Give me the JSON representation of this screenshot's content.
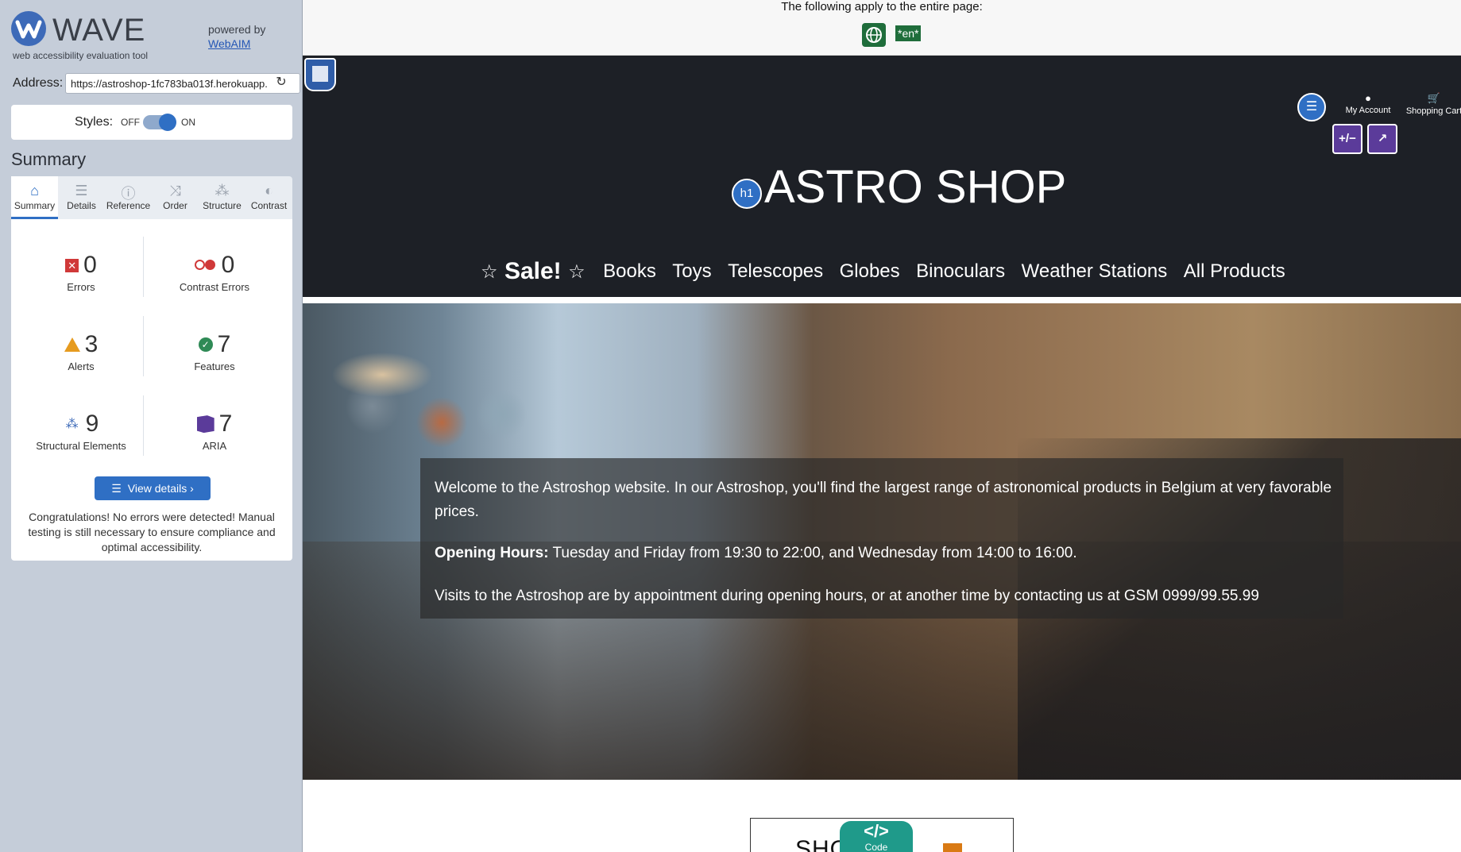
{
  "sidebar": {
    "logo_text": "WAVE",
    "logo_sub": "web accessibility evaluation tool",
    "powered_by": "powered by",
    "webaim_link": "WebAIM",
    "address_label": "Address:",
    "address_value": "https://astroshop-1fc783ba013f.herokuapp.",
    "styles_label": "Styles:",
    "styles_off": "OFF",
    "styles_on": "ON",
    "summary_title": "Summary",
    "tabs": [
      {
        "label": "Summary",
        "icon": "home-icon",
        "active": true
      },
      {
        "label": "Details",
        "icon": "list-icon",
        "active": false
      },
      {
        "label": "Reference",
        "icon": "info-icon",
        "active": false
      },
      {
        "label": "Order",
        "icon": "order-icon",
        "active": false
      },
      {
        "label": "Structure",
        "icon": "structure-icon",
        "active": false
      },
      {
        "label": "Contrast",
        "icon": "contrast-icon",
        "active": false
      }
    ],
    "stats": {
      "errors": {
        "value": "0",
        "label": "Errors"
      },
      "contrast_errors": {
        "value": "0",
        "label": "Contrast Errors"
      },
      "alerts": {
        "value": "3",
        "label": "Alerts"
      },
      "features": {
        "value": "7",
        "label": "Features"
      },
      "structural": {
        "value": "9",
        "label": "Structural Elements"
      },
      "aria": {
        "value": "7",
        "label": "ARIA"
      }
    },
    "view_details": "View details ›",
    "congrats": "Congratulations! No errors were detected! Manual testing is still necessary to ensure compliance and optimal accessibility."
  },
  "page": {
    "apply_text": "The following apply to the entire page:",
    "lang_badge": "*en*",
    "h1_badge": "h1",
    "site_title": "ASTRO SHOP",
    "account_label": "My Account",
    "cart_label": "Shopping Cart",
    "aria_badge_1": "+/−",
    "aria_badge_2": "↗",
    "nav": {
      "sale": "Sale!",
      "items": [
        "Books",
        "Toys",
        "Telescopes",
        "Globes",
        "Binoculars",
        "Weather Stations",
        "All Products"
      ]
    },
    "hero": {
      "welcome": "Welcome to the Astroshop website. In our Astroshop, you'll find the largest range of astronomical products in Belgium at very favorable prices.",
      "hours_label": "Opening Hours:",
      "hours_text": " Tuesday and Friday from 19:30 to 22:00, and Wednesday from 14:00 to 16:00.",
      "visits": "Visits to the Astroshop are by appointment during opening hours, or at another time by contacting us at GSM 0999/99.55.99"
    },
    "showbox_text": "SHOW",
    "code_label": "Code",
    "code_icon": "</>"
  },
  "colors": {
    "accent": "#2f6fc4",
    "error": "#d03939",
    "alert": "#e69b1f",
    "feature": "#2f8a56",
    "aria": "#5b3b9a",
    "header_bg": "#1d2026",
    "lang_green": "#1f6d3b"
  }
}
